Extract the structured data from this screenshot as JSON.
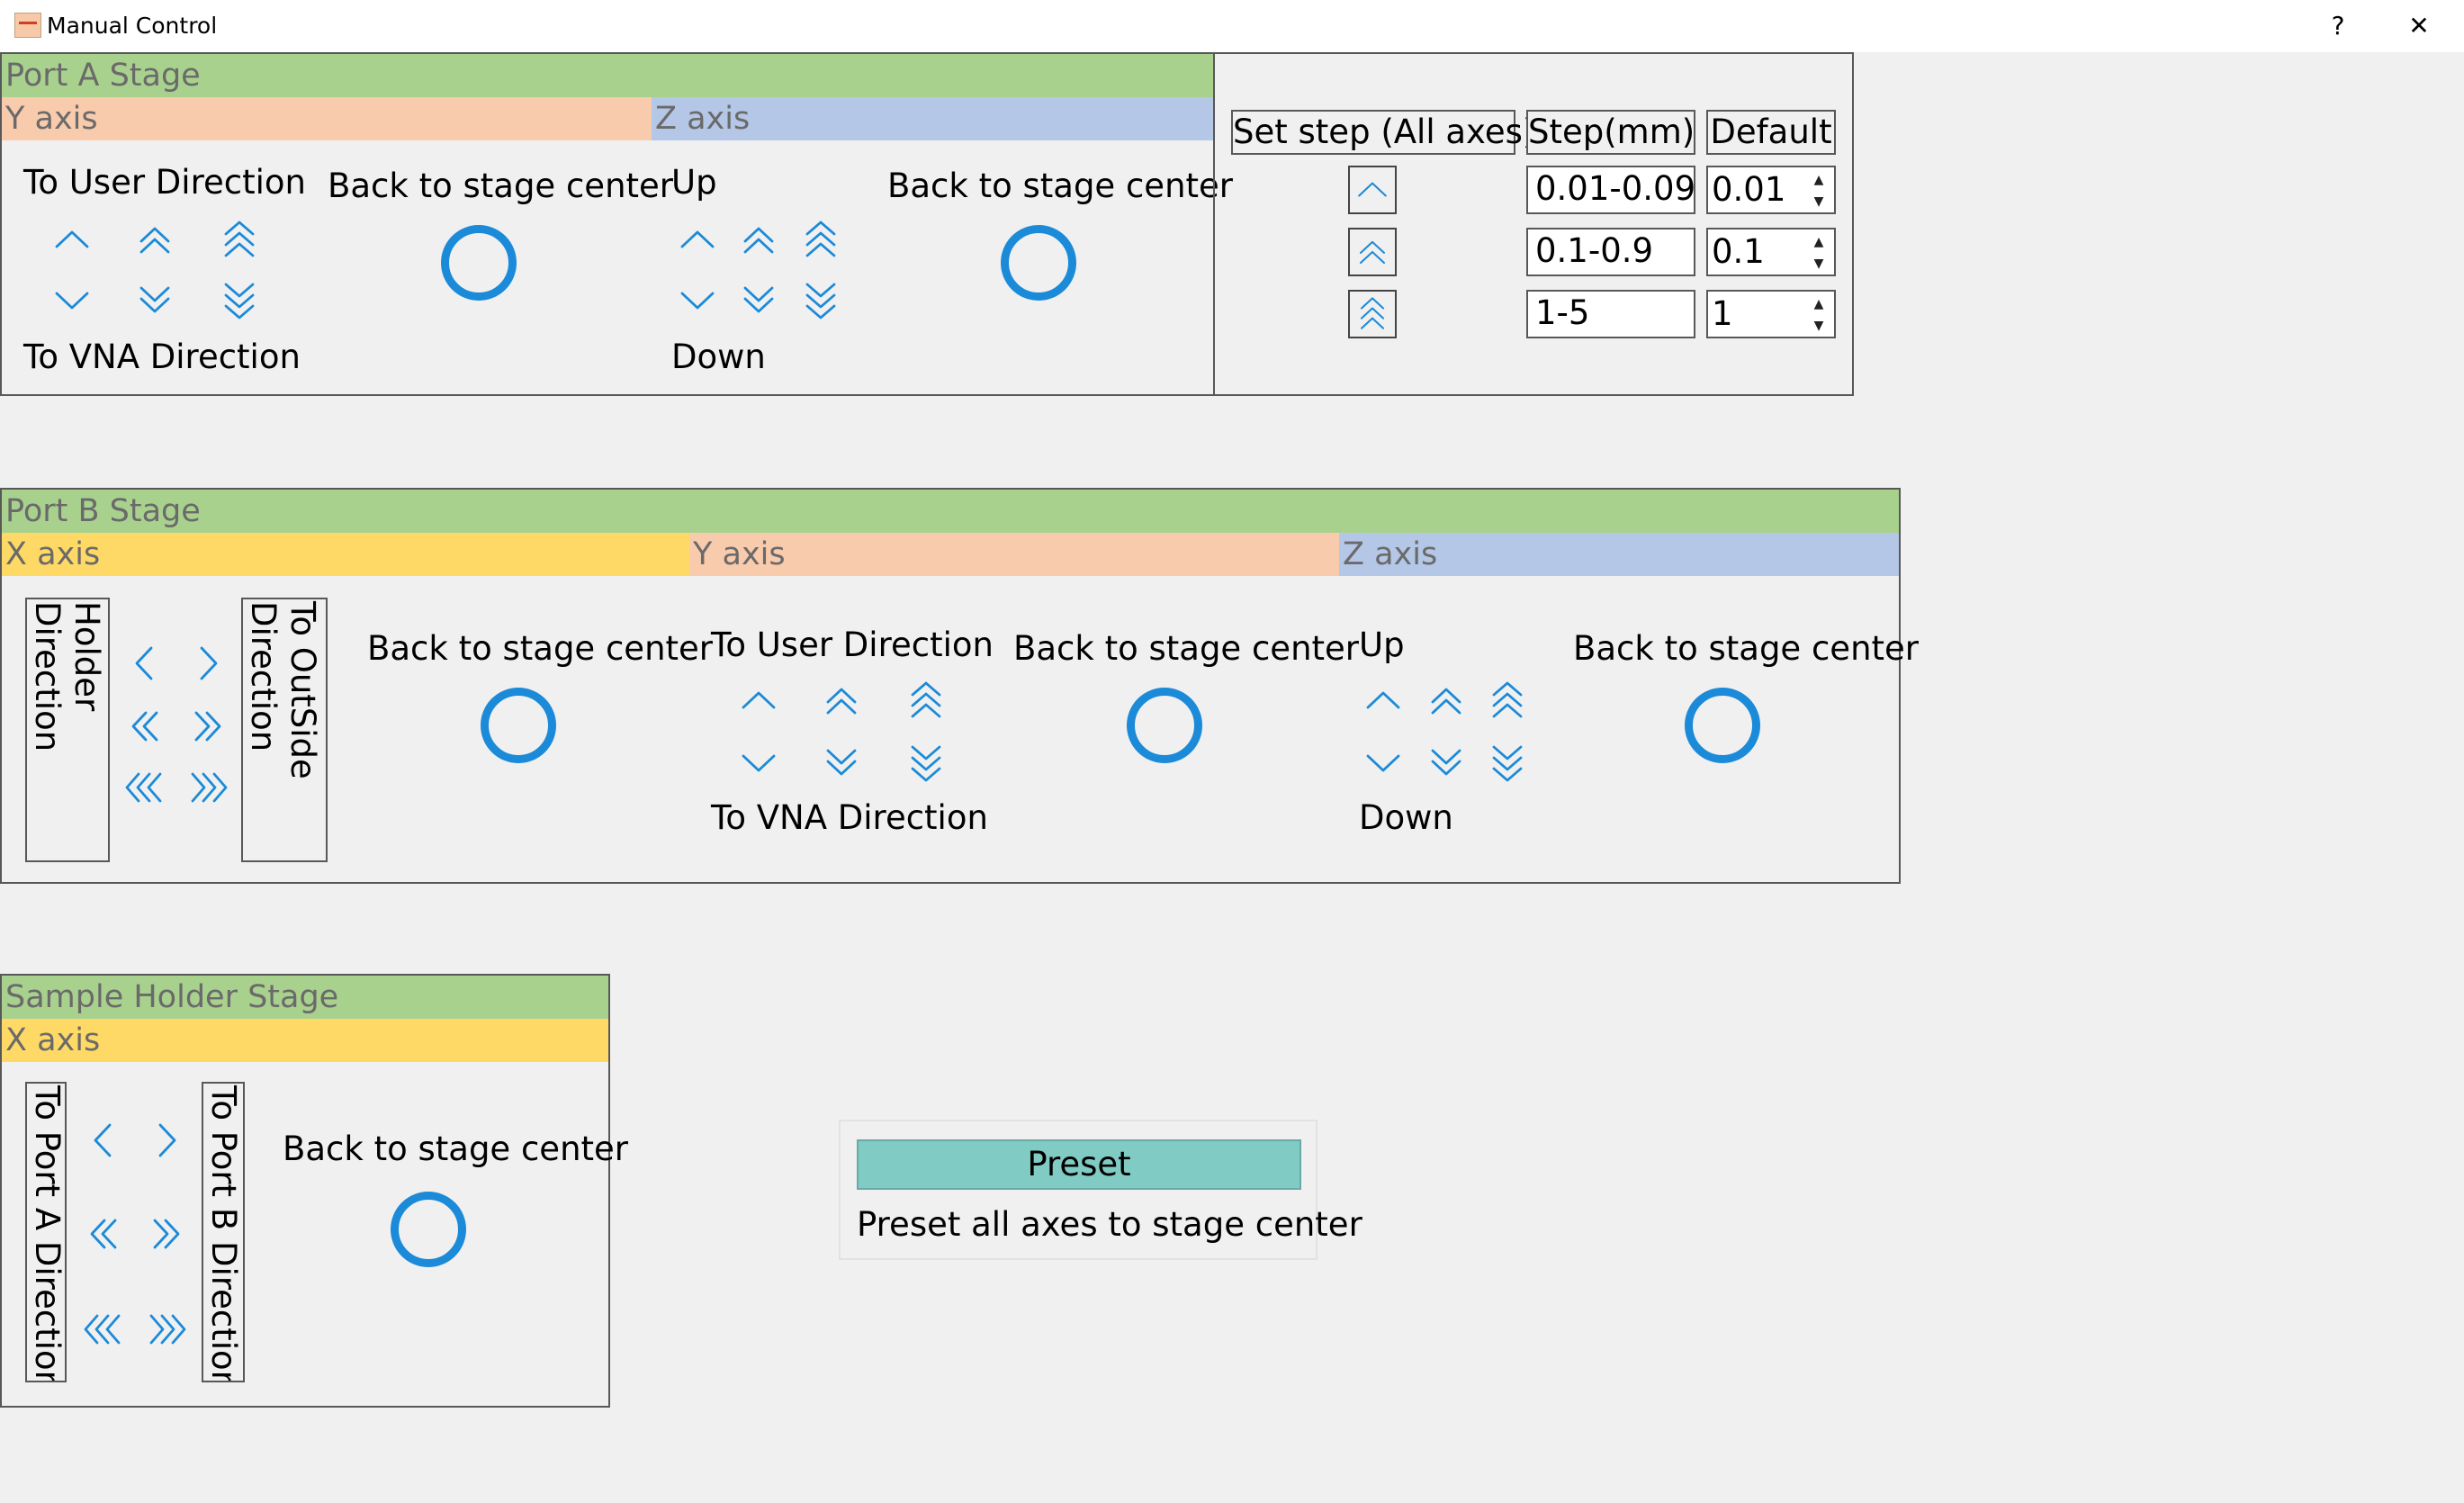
{
  "window": {
    "title": "Manual Control",
    "help_label": "?",
    "close_label": "✕"
  },
  "port_a": {
    "title": "Port A Stage",
    "y_axis": {
      "label": "Y axis",
      "top_label": "To User Direction",
      "bottom_label": "To VNA Direction",
      "center_label": "Back to stage center"
    },
    "z_axis": {
      "label": "Z axis",
      "top_label": "Up",
      "bottom_label": "Down",
      "center_label": "Back to stage center"
    }
  },
  "step_panel": {
    "header_set": "Set step (All axes)",
    "header_step": "Step(mm)",
    "header_default": "Default",
    "rows": [
      {
        "icon": "chevron-up-icon",
        "range": "0.01-0.09",
        "default": "0.01"
      },
      {
        "icon": "double-chevron-up-icon",
        "range": "0.1-0.9",
        "default": "0.1"
      },
      {
        "icon": "triple-chevron-up-icon",
        "range": "1-5",
        "default": "1"
      }
    ]
  },
  "port_b": {
    "title": "Port B Stage",
    "x_axis": {
      "label": "X axis",
      "left_label": "To Sample Holder Direction",
      "right_label": "To OutSide Direction",
      "center_label": "Back to stage center"
    },
    "y_axis": {
      "label": "Y axis",
      "top_label": "To User Direction",
      "bottom_label": "To VNA Direction",
      "center_label": "Back to stage center"
    },
    "z_axis": {
      "label": "Z axis",
      "top_label": "Up",
      "bottom_label": "Down",
      "center_label": "Back to stage center"
    }
  },
  "sample_holder": {
    "title": "Sample Holder Stage",
    "x_axis": {
      "label": "X axis",
      "left_label": "To Port A Direction",
      "right_label": "To Port B Direction",
      "center_label": "Back to stage center"
    }
  },
  "preset": {
    "button_label": "Preset",
    "description": "Preset all axes to stage center"
  },
  "colors": {
    "accent": "#1b8ad8",
    "stage_bar": "#a9d18e",
    "x_axis_bar": "#ffd966",
    "y_axis_bar": "#f8cbad",
    "z_axis_bar": "#b4c7e7",
    "preset_button": "#80cbc4"
  }
}
